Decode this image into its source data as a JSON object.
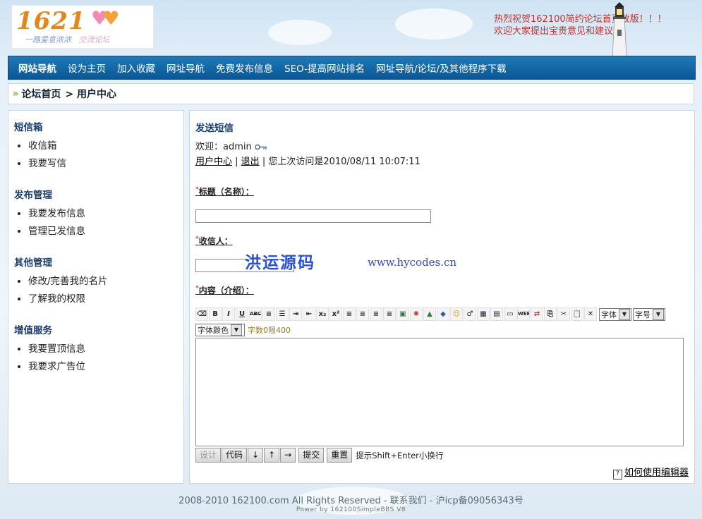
{
  "header": {
    "logo": {
      "number": "1621",
      "tagline": "一路爱意浓浓",
      "tagline2": "交流论坛"
    },
    "notice": [
      "热烈祝贺162100简约论坛首页改版！！！",
      "欢迎大家提出宝贵意见和建议！"
    ]
  },
  "nav": {
    "items": [
      "网站导航",
      "设为主页",
      "加入收藏",
      "网址导航",
      "免费发布信息",
      "SEO-提高网站排名",
      "网址导航/论坛/及其他程序下载"
    ]
  },
  "breadcrumb": {
    "home": "论坛首页",
    "current": "> 用户中心"
  },
  "sidebar": {
    "sections": [
      {
        "title": "短信箱",
        "items": [
          "收信箱",
          "我要写信"
        ]
      },
      {
        "title": "发布管理",
        "items": [
          "我要发布信息",
          "管理已发信息"
        ]
      },
      {
        "title": "其他管理",
        "items": [
          "修改/完善我的名片",
          "了解我的权限"
        ]
      },
      {
        "title": "增值服务",
        "items": [
          "我要置顶信息",
          "我要求广告位"
        ]
      }
    ]
  },
  "main": {
    "title": "发送短信",
    "welcome": "欢迎：admin",
    "user_center": "用户中心",
    "sep1": " | ",
    "logout": "退出",
    "last_visit": " | 您上次访问是2010/08/11 10:07:11",
    "label_title": "标题（名称）：",
    "label_recipient": "收信人：",
    "label_content": "内容（介绍）：",
    "watermark": "洪运源码",
    "watermark_url": "www.hycodes.cn",
    "font_select": "字体",
    "size_select": "字号",
    "color_select": "字体颜色",
    "char_limit": "字数0限400",
    "btn_design": "设计",
    "btn_code": "代码",
    "btn_down": "↓",
    "btn_up": "↑",
    "btn_right": "→",
    "btn_submit": "提交",
    "btn_reset": "重置",
    "hint": "提示Shift+Enter小换行",
    "help": "如何使用编辑器",
    "toolbar_icons": [
      "eraser",
      "B",
      "I",
      "U",
      "ABC",
      "ol",
      "ul",
      "indent",
      "outdent",
      "sub",
      "sup",
      "align-left",
      "align-center",
      "align-justify",
      "align-right",
      "image",
      "flash",
      "media",
      "link",
      "emoticon",
      "special-char",
      "table",
      "hr",
      "box",
      "web",
      "swap",
      "copy",
      "cut",
      "paste",
      "close"
    ]
  },
  "footer": {
    "text": "2008-2010 162100.com All Rights Reserved - 联系我们  - 沪icp备09056343号",
    "powered": "Power by 162100SimpleBBS V8"
  }
}
